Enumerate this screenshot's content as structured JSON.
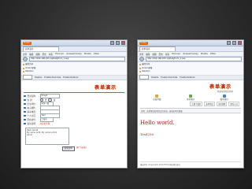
{
  "browser": {
    "app_badge": "Firefox",
    "tab_title": "表单演示",
    "menu": [
      "文件",
      "编辑",
      "视图",
      "历史",
      "书签",
      "Hoxxvpn",
      "Greasemonkey",
      "Mozilla",
      "Other"
    ],
    "left_url": "http://192.168.183.1/pfkstj/form_1.asp",
    "right_url": "http://192.168.183.1/pfkstj/form_2.asp",
    "bookmarks": [
      "最常访问",
      "Gmail 邮箱",
      "Rakuten"
    ],
    "dev_items": [
      "Disable",
      "Enable Post data",
      "Enable Referrer"
    ]
  },
  "left": {
    "logo": "表单演示",
    "rows": [
      {
        "label": "登录名称：",
        "value": "Dingdi"
      },
      {
        "label": "性    别：",
        "value": "男",
        "alt": "女"
      },
      {
        "label": "出生年份：",
        "value": "年份一级"
      },
      {
        "label": "电子邮件：",
        "value": ""
      },
      {
        "label": "联系电话：",
        "value": ""
      },
      {
        "label": "个人主页：",
        "value": "Tasil"
      },
      {
        "label": "所在省份：",
        "value": "上海市"
      },
      {
        "label": "备注说明：",
        "value": "对应的字段"
      }
    ],
    "textarea": "Hello world!\nMy name is Mr. My name is Dirk\nAbout",
    "submit": "提交表单",
    "required_note": "(带*为必填)"
  },
  "right": {
    "logo": "表单演示",
    "subtitle": "我要就是我的项目",
    "nav": [
      "在线下载",
      "关于我们",
      "联系我们"
    ],
    "tabs": [
      "注册下载区",
      "表单测试",
      "文档资料",
      "联系方式"
    ],
    "pagebar": "说明：这里将是表单提交的页面，接收表单的数据",
    "hello": "Hello world.",
    "name": "Tasil256",
    "footer": "版权所有 (Copyright) 2010 FKSTJ 网站测试演示"
  }
}
